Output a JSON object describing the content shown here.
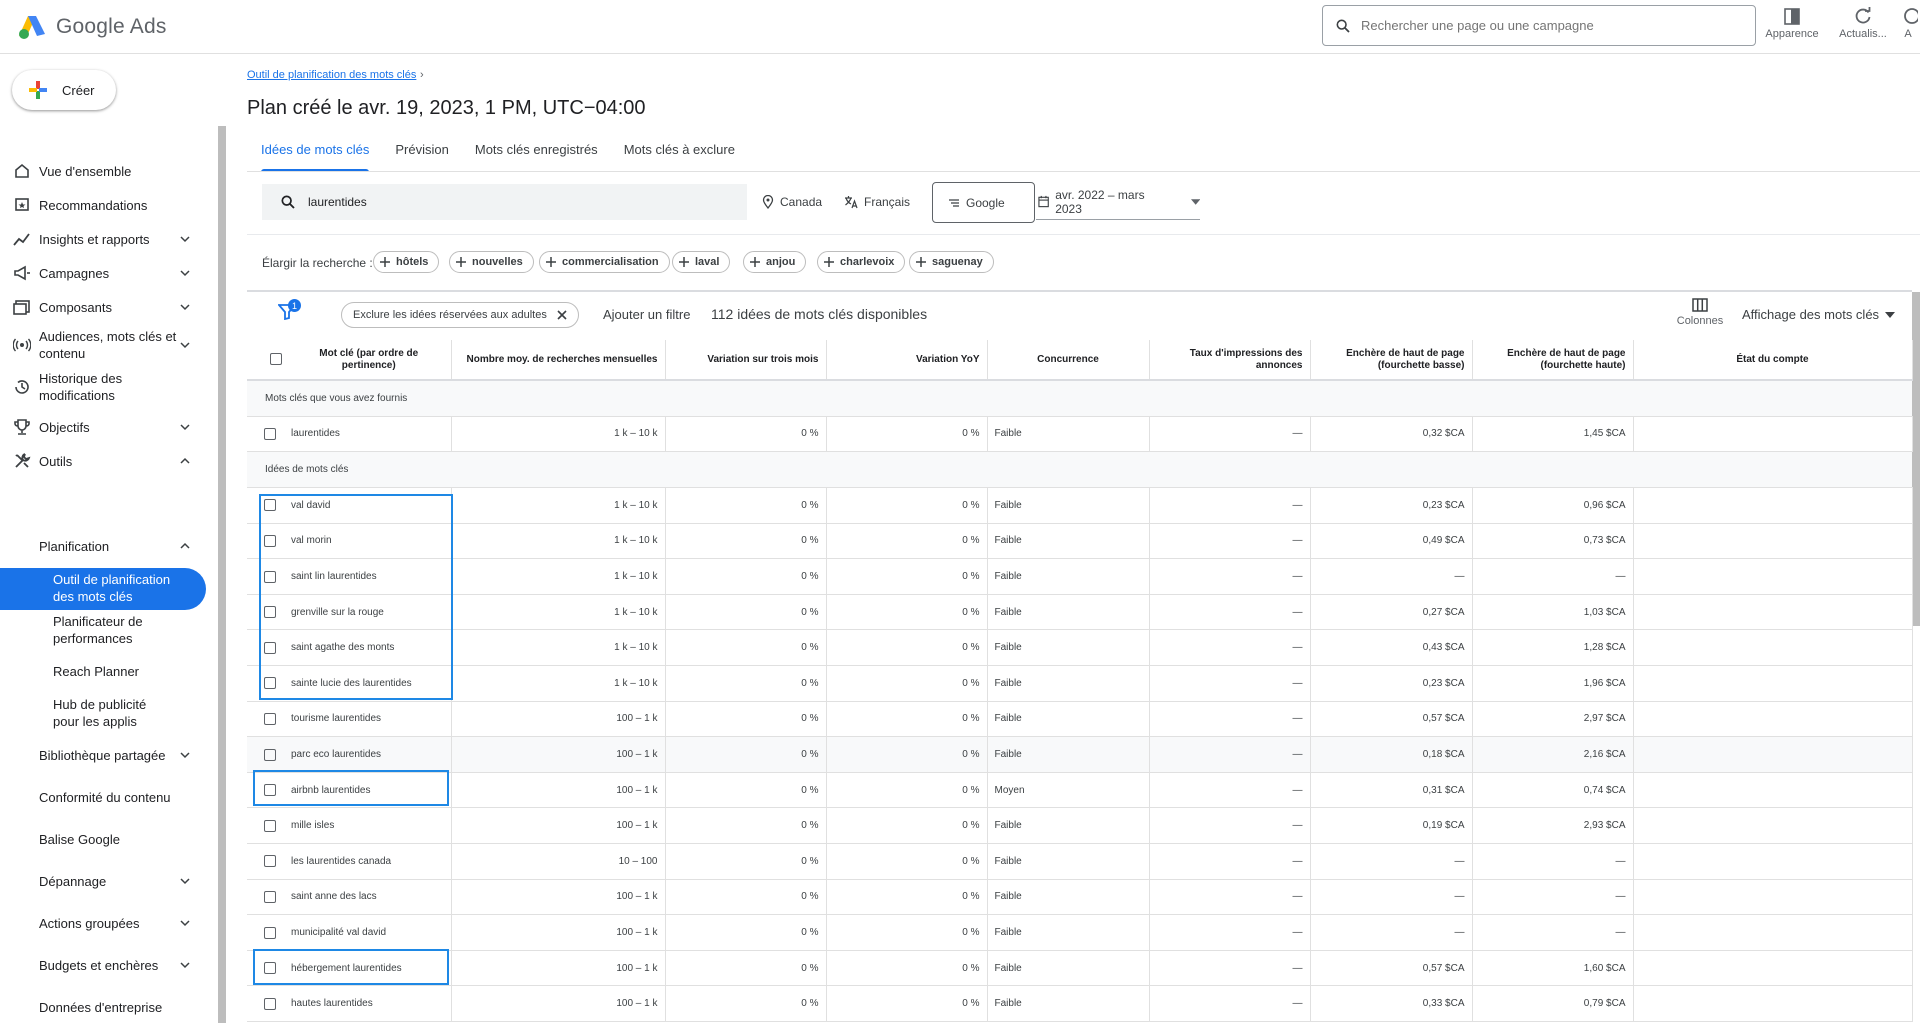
{
  "app": {
    "title": "Google Ads"
  },
  "topbar": {
    "search_placeholder": "Rechercher une page ou une campagne",
    "tools": [
      {
        "label": "Apparence",
        "icon": "appearance-icon"
      },
      {
        "label": "Actualis...",
        "icon": "refresh-icon"
      }
    ],
    "edge_label": "A"
  },
  "sidebar": {
    "create_label": "Créer",
    "items": [
      {
        "label": "Vue d'ensemble",
        "icon": "home-icon"
      },
      {
        "label": "Recommandations",
        "icon": "recommendations-icon"
      },
      {
        "label": "Insights et rapports",
        "icon": "insights-icon"
      },
      {
        "label": "Campagnes",
        "icon": "campaigns-icon"
      },
      {
        "label": "Composants",
        "icon": "assets-icon"
      },
      {
        "label": "Audiences, mots clés et contenu",
        "icon": "audiences-icon"
      },
      {
        "label": "Historique des modifications",
        "icon": "history-icon"
      },
      {
        "label": "Objectifs",
        "icon": "trophy-icon"
      },
      {
        "label": "Outils",
        "icon": "tools-icon"
      }
    ],
    "planning_label": "Planification",
    "planning_items": [
      "Outil de planification des mots clés",
      "Planificateur de performances",
      "Reach Planner",
      "Hub de publicité pour les applis"
    ],
    "tool_items": [
      "Bibliothèque partagée",
      "Conformité du contenu",
      "Balise Google",
      "Dépannage",
      "Actions groupées",
      "Budgets et enchères",
      "Données d'entreprise"
    ]
  },
  "main": {
    "breadcrumb": "Outil de planification des mots clés",
    "breadcrumb_sep": "›",
    "title": "Plan créé le avr. 19, 2023, 1 PM, UTC−04:00",
    "tabs": [
      "Idées de mots clés",
      "Prévision",
      "Mots clés enregistrés",
      "Mots clés à exclure"
    ],
    "search_value": "laurentides",
    "location": "Canada",
    "language": "Français",
    "network": "Google",
    "date_range": "avr. 2022 – mars 2023",
    "broaden_label": "Élargir la recherche :",
    "broaden_chips": [
      "hôtels",
      "nouvelles",
      "commercialisation",
      "laval",
      "anjou",
      "charlevoix",
      "saguenay"
    ],
    "filter_count": "1",
    "exclude_chip": "Exclure les idées réservées aux adultes",
    "add_filter": "Ajouter un filtre",
    "available": "112 idées de mots clés disponibles",
    "columns_label": "Colonnes",
    "view_label": "Affichage des mots clés"
  },
  "table": {
    "headers": [
      "Mot clé (par ordre de pertinence)",
      "Nombre moy. de recherches mensuelles",
      "Variation sur trois mois",
      "Variation YoY",
      "Concurrence",
      "Taux d'impressions des annonces",
      "Enchère de haut de page (fourchette basse)",
      "Enchère de haut de page (fourchette haute)",
      "État du compte"
    ],
    "section_provided": "Mots clés que vous avez fournis",
    "section_ideas": "Idées de mots clés",
    "provided": [
      {
        "kw": "laurentides",
        "avg": "1 k – 10 k",
        "three": "0 %",
        "yoy": "0 %",
        "comp": "Faible",
        "impr": "—",
        "low": "0,32 $CA",
        "high": "1,45 $CA",
        "state": ""
      }
    ],
    "ideas": [
      {
        "kw": "val david",
        "avg": "1 k – 10 k",
        "three": "0 %",
        "yoy": "0 %",
        "comp": "Faible",
        "impr": "—",
        "low": "0,23 $CA",
        "high": "0,96 $CA",
        "state": ""
      },
      {
        "kw": "val morin",
        "avg": "1 k – 10 k",
        "three": "0 %",
        "yoy": "0 %",
        "comp": "Faible",
        "impr": "—",
        "low": "0,49 $CA",
        "high": "0,73 $CA",
        "state": ""
      },
      {
        "kw": "saint lin laurentides",
        "avg": "1 k – 10 k",
        "three": "0 %",
        "yoy": "0 %",
        "comp": "Faible",
        "impr": "—",
        "low": "—",
        "high": "—",
        "state": ""
      },
      {
        "kw": "grenville sur la rouge",
        "avg": "1 k – 10 k",
        "three": "0 %",
        "yoy": "0 %",
        "comp": "Faible",
        "impr": "—",
        "low": "0,27 $CA",
        "high": "1,03 $CA",
        "state": ""
      },
      {
        "kw": "saint agathe des monts",
        "avg": "1 k – 10 k",
        "three": "0 %",
        "yoy": "0 %",
        "comp": "Faible",
        "impr": "—",
        "low": "0,43 $CA",
        "high": "1,28 $CA",
        "state": ""
      },
      {
        "kw": "sainte lucie des laurentides",
        "avg": "1 k – 10 k",
        "three": "0 %",
        "yoy": "0 %",
        "comp": "Faible",
        "impr": "—",
        "low": "0,23 $CA",
        "high": "1,96 $CA",
        "state": ""
      },
      {
        "kw": "tourisme laurentides",
        "avg": "100 – 1 k",
        "three": "0 %",
        "yoy": "0 %",
        "comp": "Faible",
        "impr": "—",
        "low": "0,57 $CA",
        "high": "2,97 $CA",
        "state": ""
      },
      {
        "kw": "parc eco laurentides",
        "avg": "100 – 1 k",
        "three": "0 %",
        "yoy": "0 %",
        "comp": "Faible",
        "impr": "—",
        "low": "0,18 $CA",
        "high": "2,16 $CA",
        "state": ""
      },
      {
        "kw": "airbnb laurentides",
        "avg": "100 – 1 k",
        "three": "0 %",
        "yoy": "0 %",
        "comp": "Moyen",
        "impr": "—",
        "low": "0,31 $CA",
        "high": "0,74 $CA",
        "state": ""
      },
      {
        "kw": "mille isles",
        "avg": "100 – 1 k",
        "three": "0 %",
        "yoy": "0 %",
        "comp": "Faible",
        "impr": "—",
        "low": "0,19 $CA",
        "high": "2,93 $CA",
        "state": ""
      },
      {
        "kw": "les laurentides canada",
        "avg": "10 – 100",
        "three": "0 %",
        "yoy": "0 %",
        "comp": "Faible",
        "impr": "—",
        "low": "—",
        "high": "—",
        "state": ""
      },
      {
        "kw": "saint anne des lacs",
        "avg": "100 – 1 k",
        "three": "0 %",
        "yoy": "0 %",
        "comp": "Faible",
        "impr": "—",
        "low": "—",
        "high": "—",
        "state": ""
      },
      {
        "kw": "municipalité val david",
        "avg": "100 – 1 k",
        "three": "0 %",
        "yoy": "0 %",
        "comp": "Faible",
        "impr": "—",
        "low": "—",
        "high": "—",
        "state": ""
      },
      {
        "kw": "hébergement laurentides",
        "avg": "100 – 1 k",
        "three": "0 %",
        "yoy": "0 %",
        "comp": "Faible",
        "impr": "—",
        "low": "0,57 $CA",
        "high": "1,60 $CA",
        "state": ""
      },
      {
        "kw": "hautes laurentides",
        "avg": "100 – 1 k",
        "three": "0 %",
        "yoy": "0 %",
        "comp": "Faible",
        "impr": "—",
        "low": "0,33 $CA",
        "high": "0,79 $CA",
        "state": ""
      }
    ]
  },
  "colors": {
    "accent": "#1a73e8",
    "highlight": "#1e88e5"
  }
}
